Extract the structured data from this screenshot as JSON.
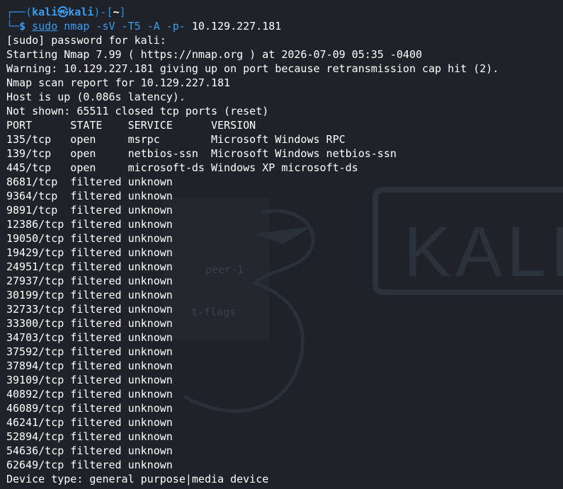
{
  "prompt": {
    "corner_top": "┌──(",
    "user": "kali",
    "at_symbol": "㉿",
    "host": "kali",
    "close_paren": ")-[",
    "dir": "~",
    "close_bracket": "]",
    "corner_bottom": "└─",
    "dollar": "$",
    "sudo": "sudo",
    "cmd": "nmap",
    "flags": "-sV -T5 -A -p-",
    "target": "10.129.227.181"
  },
  "output": [
    "[sudo] password for kali:",
    "Starting Nmap 7.99 ( https://nmap.org ) at 2026-07-09 05:35 -0400",
    "Warning: 10.129.227.181 giving up on port because retransmission cap hit (2).",
    "Nmap scan report for 10.129.227.181",
    "Host is up (0.086s latency).",
    "Not shown: 65511 closed tcp ports (reset)",
    "PORT      STATE    SERVICE      VERSION",
    "135/tcp   open     msrpc        Microsoft Windows RPC",
    "139/tcp   open     netbios-ssn  Microsoft Windows netbios-ssn",
    "445/tcp   open     microsoft-ds Windows XP microsoft-ds",
    "8681/tcp  filtered unknown",
    "9364/tcp  filtered unknown",
    "9891/tcp  filtered unknown",
    "12386/tcp filtered unknown",
    "19050/tcp filtered unknown",
    "19429/tcp filtered unknown",
    "24951/tcp filtered unknown",
    "27937/tcp filtered unknown",
    "30199/tcp filtered unknown",
    "32733/tcp filtered unknown",
    "33300/tcp filtered unknown",
    "34703/tcp filtered unknown",
    "37592/tcp filtered unknown",
    "37894/tcp filtered unknown",
    "39109/tcp filtered unknown",
    "40892/tcp filtered unknown",
    "46089/tcp filtered unknown",
    "46241/tcp filtered unknown",
    "52894/tcp filtered unknown",
    "54636/tcp filtered unknown",
    "62649/tcp filtered unknown",
    "Device type: general purpose|media device"
  ],
  "wallpaper": {
    "logo_text": "KALI",
    "ghost_text_1": "peer-1",
    "ghost_text_2": "t-flags"
  },
  "colors": {
    "background": "#1f2329",
    "prompt_blue": "#2f8fe8",
    "text": "#ffffff"
  }
}
